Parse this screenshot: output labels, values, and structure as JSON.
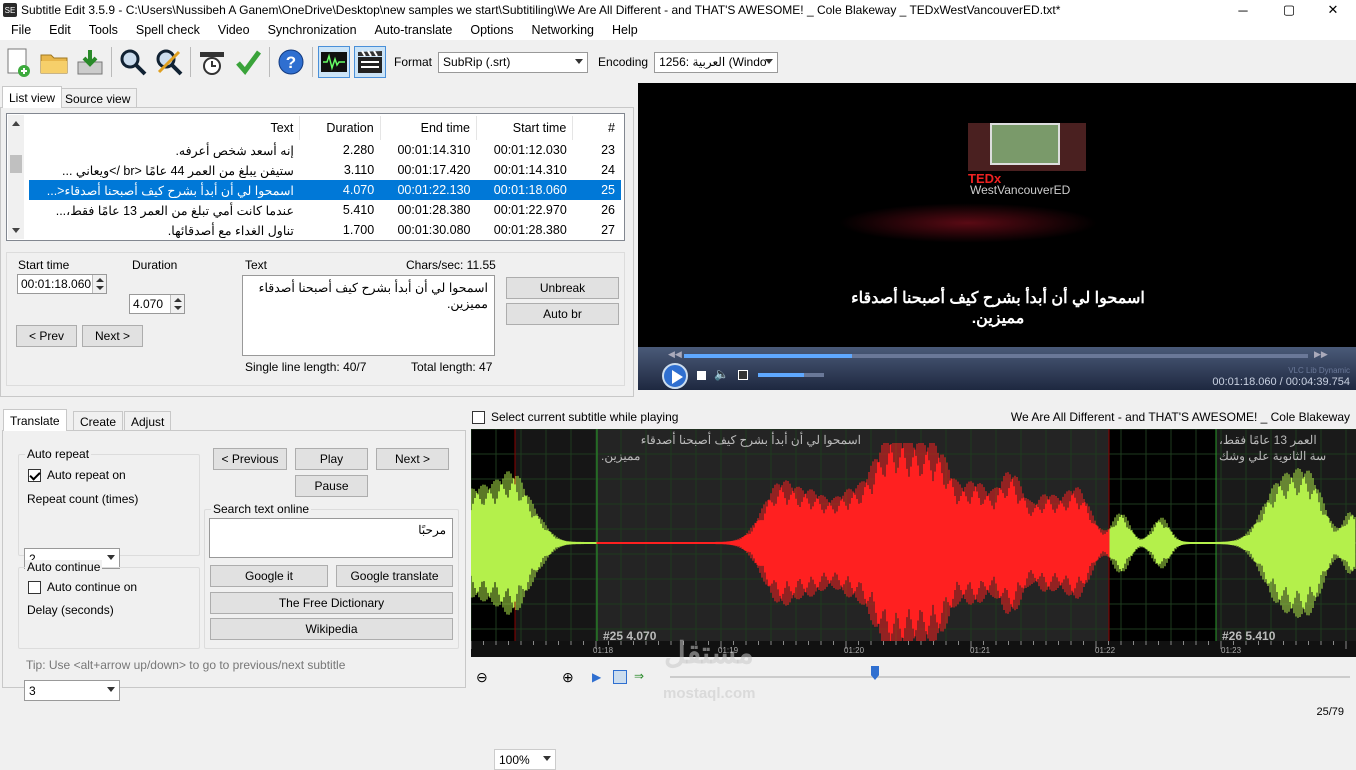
{
  "window": {
    "title": "Subtitle Edit 3.5.9 - C:\\Users\\Nussibeh A Ganem\\OneDrive\\Desktop\\new samples we start\\Subtitiling\\We Are All Different - and THAT'S AWESOME! _ Cole Blakeway _ TEDxWestVancouverED.txt*",
    "minimize": "─",
    "maximize": "▢",
    "close": "✕",
    "app_icon": "SE"
  },
  "menu": [
    "File",
    "Edit",
    "Tools",
    "Spell check",
    "Video",
    "Synchronization",
    "Auto-translate",
    "Options",
    "Networking",
    "Help"
  ],
  "toolbar": {
    "format_label": "Format",
    "format_value": "SubRip (.srt)",
    "encoding_label": "Encoding",
    "encoding_value": "1256: العربية (Windo"
  },
  "view_tabs": {
    "list": "List view",
    "source": "Source view"
  },
  "grid": {
    "headers": {
      "text": "Text",
      "duration": "Duration",
      "end": "End time",
      "start": "Start time",
      "num": "#"
    },
    "rows": [
      {
        "text": "إنه أسعد شخص أعرفه.",
        "duration": "2.280",
        "end": "00:01:14.310",
        "start": "00:01:12.030",
        "num": "23"
      },
      {
        "text": "ستيفن يبلغ من العمر 44 عامًا <br />ويعاني ...",
        "duration": "3.110",
        "end": "00:01:17.420",
        "start": "00:01:14.310",
        "num": "24"
      },
      {
        "text": "اسمحوا لي أن أبدأ بشرح كيف أصبحنا أصدقاء<...",
        "duration": "4.070",
        "end": "00:01:22.130",
        "start": "00:01:18.060",
        "num": "25"
      },
      {
        "text": "عندما كانت أمي تبلغ من العمر 13 عامًا فقط،...",
        "duration": "5.410",
        "end": "00:01:28.380",
        "start": "00:01:22.970",
        "num": "26"
      },
      {
        "text": "تناول الغداء مع أصدقائها.",
        "duration": "1.700",
        "end": "00:01:30.080",
        "start": "00:01:28.380",
        "num": "27"
      }
    ]
  },
  "editor": {
    "start_label": "Start time",
    "start_value": "00:01:18.060",
    "duration_label": "Duration",
    "duration_value": "4.070",
    "text_label": "Text",
    "chars_sec": "Chars/sec: 11.55",
    "text_value": "اسمحوا لي أن أبدأ بشرح كيف أصبحنا أصدقاء مميزين.",
    "single_len": "Single line length: 40/7",
    "total_len": "Total length: 47",
    "unbreak": "Unbreak",
    "auto_br": "Auto br",
    "prev": "< Prev",
    "next": "Next >"
  },
  "video": {
    "subtitle_line1": "اسمحوا لي أن أبدأ بشرح كيف أصبحنا أصدقاء",
    "subtitle_line2": "مميزين.",
    "tedx_text": "TEDx",
    "venue_text": "WestVancouverED",
    "time": "00:01:18.060 / 00:04:39.754",
    "vlc": "VLC Lib Dynamic",
    "progress": 0.27,
    "volume": 0.7
  },
  "bottom_tabs": {
    "translate": "Translate",
    "create": "Create",
    "adjust": "Adjust"
  },
  "translate": {
    "auto_repeat_group": "Auto repeat",
    "auto_repeat_on": "Auto repeat on",
    "repeat_count_label": "Repeat count (times)",
    "repeat_count": "2",
    "auto_continue_group": "Auto continue",
    "auto_continue_on": "Auto continue on",
    "delay_label": "Delay (seconds)",
    "delay": "3",
    "previous": "< Previous",
    "play": "Play",
    "next": "Next >",
    "pause": "Pause",
    "search_group": "Search text online",
    "search_text": "مرحبًا",
    "google_it": "Google it",
    "google_translate": "Google translate",
    "free_dictionary": "The Free Dictionary",
    "wikipedia": "Wikipedia",
    "tip": "Tip: Use <alt+arrow up/down> to go to previous/next subtitle"
  },
  "waveform": {
    "select_current": "Select current subtitle while playing",
    "file_title": "We Are All Different - and THAT'S AWESOME! _ Cole Blakeway",
    "left_sub_line1": "اسمحوا لي أن أبدأ بشرح كيف أصبحنا أصدقاء",
    "left_sub_line2": "مميزين.",
    "right_sub_line1": "العمر 13 عامًا فقط،",
    "right_sub_line2": "سة الثانوية علي وشك",
    "label_25": "#25  4.070",
    "label_26": "#26  5.410",
    "ticks": [
      "01:18",
      "01:19",
      "01:20",
      "01:21",
      "01:22",
      "01:23"
    ],
    "zoom": "100%"
  },
  "status": {
    "position": "25/79"
  },
  "watermark": {
    "line1": "مستقل",
    "line2": "mostaql.com"
  },
  "colors": {
    "selection": "#0078d7",
    "wave_green": "#b4f04b",
    "wave_red": "#ff2020"
  }
}
